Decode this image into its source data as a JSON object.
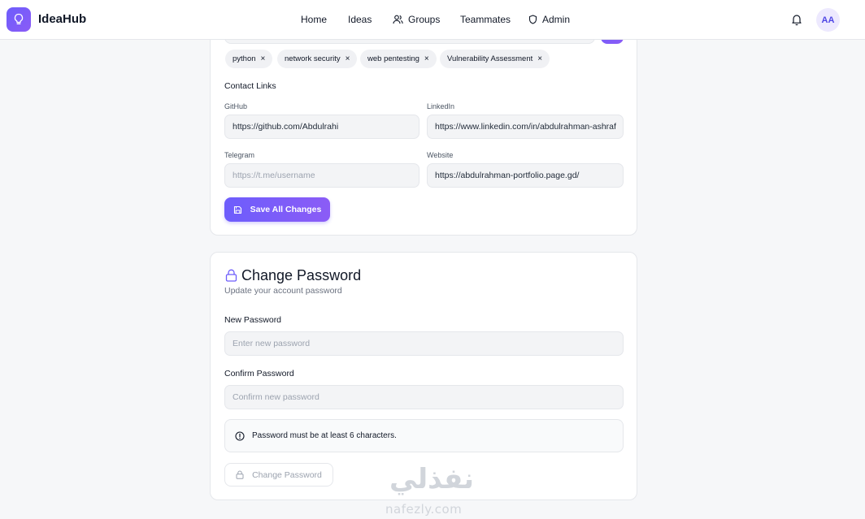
{
  "app": {
    "brand": "IdeaHub"
  },
  "nav": {
    "items": [
      {
        "label": "Home"
      },
      {
        "label": "Ideas"
      },
      {
        "label": "Groups"
      },
      {
        "label": "Teammates"
      },
      {
        "label": "Admin"
      }
    ]
  },
  "user": {
    "initials": "AA"
  },
  "skills": {
    "tags": [
      {
        "label": "python"
      },
      {
        "label": "network security"
      },
      {
        "label": "web pentesting"
      },
      {
        "label": "Vulnerability Assessment"
      }
    ],
    "remove_glyph": "×"
  },
  "contact": {
    "heading": "Contact Links",
    "github": {
      "label": "GitHub",
      "value": "https://github.com/Abdulrahi"
    },
    "linkedin": {
      "label": "LinkedIn",
      "value": "https://www.linkedin.com/in/abdulrahman-ashraf"
    },
    "telegram": {
      "label": "Telegram",
      "value": "",
      "placeholder": "https://t.me/username"
    },
    "website": {
      "label": "Website",
      "value": "https://abdulrahman-portfolio.page.gd/"
    },
    "save_label": "Save All Changes"
  },
  "password": {
    "title": "Change Password",
    "subtitle": "Update your account password",
    "new_label": "New Password",
    "new_placeholder": "Enter new password",
    "confirm_label": "Confirm Password",
    "confirm_placeholder": "Confirm new password",
    "info": "Password must be at least 6 characters.",
    "button_label": "Change Password"
  },
  "watermark": {
    "arabic": "نفذلي",
    "latin": "nafezly.com"
  },
  "colors": {
    "accent": "#6d5dfc",
    "accent_light": "#8b5cf6",
    "page_bg": "#f6f7f9",
    "input_bg": "#f3f4f6"
  }
}
